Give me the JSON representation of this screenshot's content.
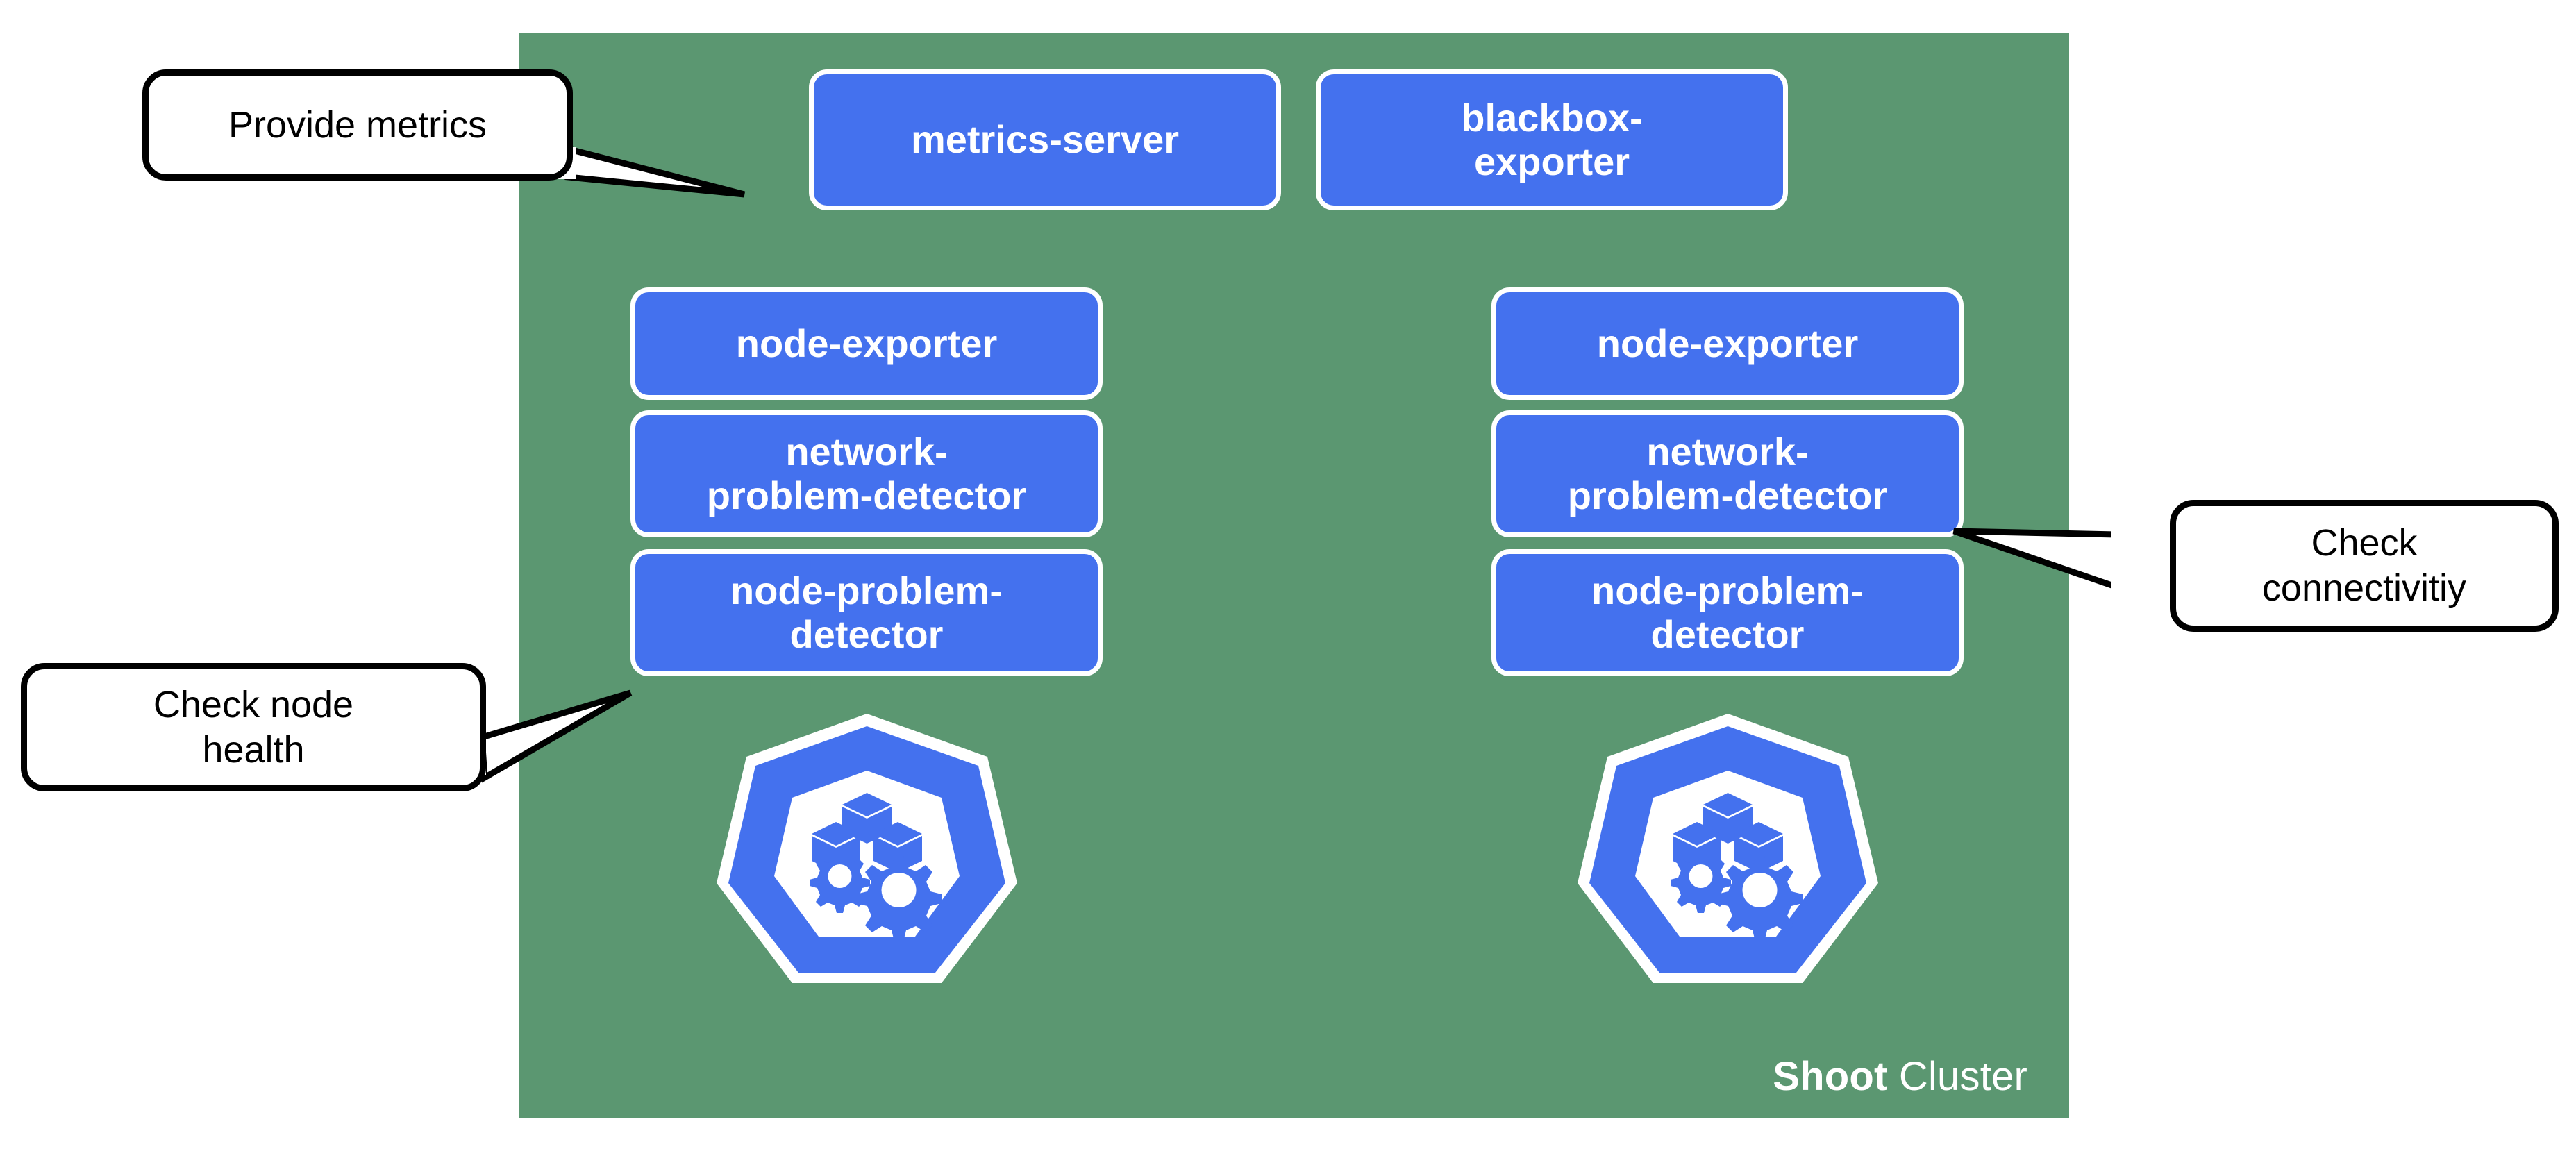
{
  "diagram": {
    "title_visible": false,
    "colors": {
      "cluster_panel": "#5B9771",
      "component_box": "#4471EE",
      "component_box_border": "#FFFFFF",
      "component_text": "#FFFFFF",
      "callout_bg": "#FFFFFF",
      "callout_border": "#000000",
      "callout_text": "#000000",
      "node_icon_fill": "#4471EE",
      "node_icon_inner": "#FFFFFF",
      "page_bg": "#FFFFFF"
    }
  },
  "cluster": {
    "label_bold": "Shoot",
    "label_regular": " Cluster"
  },
  "top_components": [
    {
      "id": "metrics-server",
      "label": "metrics-server"
    },
    {
      "id": "blackbox-exporter",
      "label": "blackbox-\nexporter"
    }
  ],
  "nodes": [
    {
      "id": "node-left",
      "icon": "kubernetes-node-icon",
      "components": [
        {
          "id": "node-exporter-left",
          "label": "node-exporter"
        },
        {
          "id": "network-problem-detector-left",
          "label": "network-\nproblem-detector"
        },
        {
          "id": "node-problem-detector-left",
          "label": "node-problem-\ndetector"
        }
      ]
    },
    {
      "id": "node-right",
      "icon": "kubernetes-node-icon",
      "components": [
        {
          "id": "node-exporter-right",
          "label": "node-exporter"
        },
        {
          "id": "network-problem-detector-right",
          "label": "network-\nproblem-detector"
        },
        {
          "id": "node-problem-detector-right",
          "label": "node-problem-\ndetector"
        }
      ]
    }
  ],
  "callouts": [
    {
      "id": "provide-metrics",
      "text": "Provide metrics",
      "points_to": "metrics-server",
      "side": "left"
    },
    {
      "id": "check-node-health",
      "text": "Check node\nhealth",
      "points_to": "node-problem-detector-left",
      "side": "left"
    },
    {
      "id": "check-connectivity",
      "text": "Check\nconnectivitiy",
      "points_to": "network-problem-detector-right",
      "side": "right"
    }
  ]
}
